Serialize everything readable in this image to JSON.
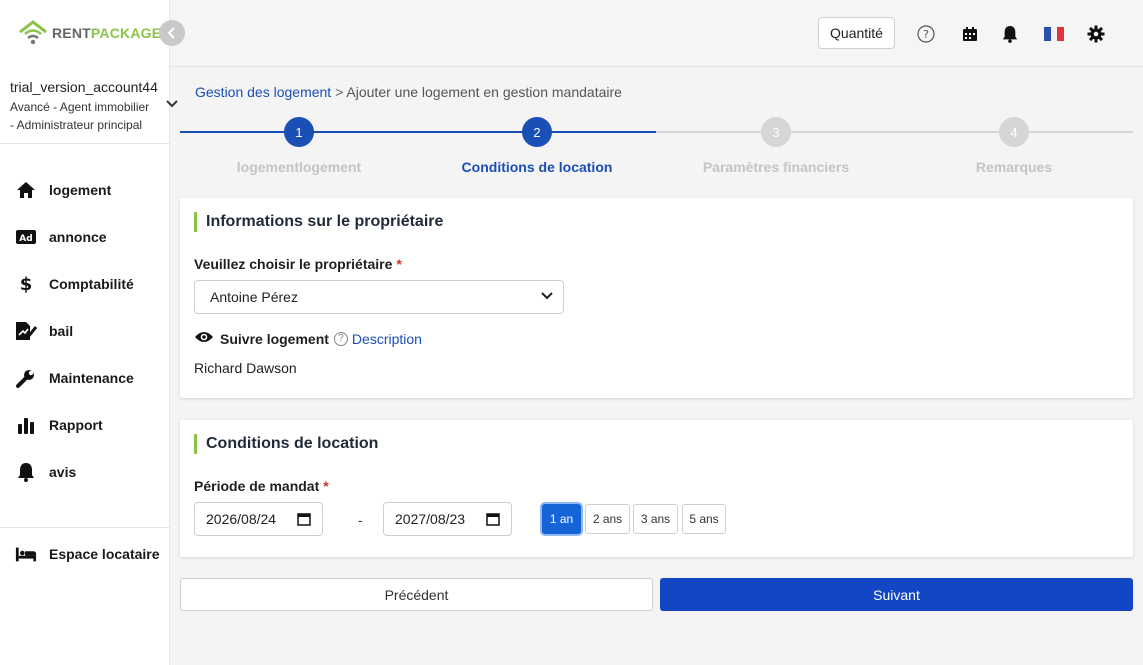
{
  "app": {
    "logo_part1": "RENT",
    "logo_part2": "PACKAGE"
  },
  "account": {
    "name": "trial_version_account44",
    "role_line1": "Avancé - Agent immobilier",
    "role_line2": "- Administrateur principal"
  },
  "sidebar": {
    "items": [
      {
        "label": "logement",
        "icon": "home-icon"
      },
      {
        "label": "annonce",
        "icon": "ad-icon"
      },
      {
        "label": "Comptabilité",
        "icon": "dollar-icon"
      },
      {
        "label": "bail",
        "icon": "contract-icon"
      },
      {
        "label": "Maintenance",
        "icon": "wrench-icon"
      },
      {
        "label": "Rapport",
        "icon": "bar-chart-icon"
      },
      {
        "label": "avis",
        "icon": "bell-icon"
      }
    ],
    "tenant_space": "Espace locataire"
  },
  "topbar": {
    "quantity_label": "Quantité"
  },
  "breadcrumb": {
    "parent": "Gestion des logement",
    "separator": ">",
    "current": "Ajouter une logement en gestion mandataire"
  },
  "stepper": {
    "steps": [
      {
        "number": "1",
        "label": "logementlogement",
        "state": "done"
      },
      {
        "number": "2",
        "label": "Conditions de location",
        "state": "active"
      },
      {
        "number": "3",
        "label": "Paramètres financiers",
        "state": "pending"
      },
      {
        "number": "4",
        "label": "Remarques",
        "state": "pending"
      }
    ]
  },
  "owner_section": {
    "title": "Informations sur le propriétaire",
    "choose_label": "Veuillez choisir le propriétaire",
    "required_mark": "*",
    "selected_owner": "Antoine Pérez",
    "follow_label": "Suivre logement",
    "description_link": "Description",
    "owner_display": "Richard Dawson"
  },
  "rental_section": {
    "title": "Conditions de location",
    "period_label": "Période de mandat",
    "required_mark": "*",
    "start_date": "2026/08/24",
    "date_separator": "-",
    "end_date": "2027/08/23",
    "durations": [
      {
        "label": "1 an",
        "active": true
      },
      {
        "label": "2 ans",
        "active": false
      },
      {
        "label": "3 ans",
        "active": false
      },
      {
        "label": "5 ans",
        "active": false
      }
    ]
  },
  "actions": {
    "previous": "Précédent",
    "next": "Suivant"
  },
  "colors": {
    "primary": "#1346c4",
    "accent_green": "#8bc34a",
    "step_done": "#1a4fb5",
    "step_pending": "#d6d6d6"
  }
}
